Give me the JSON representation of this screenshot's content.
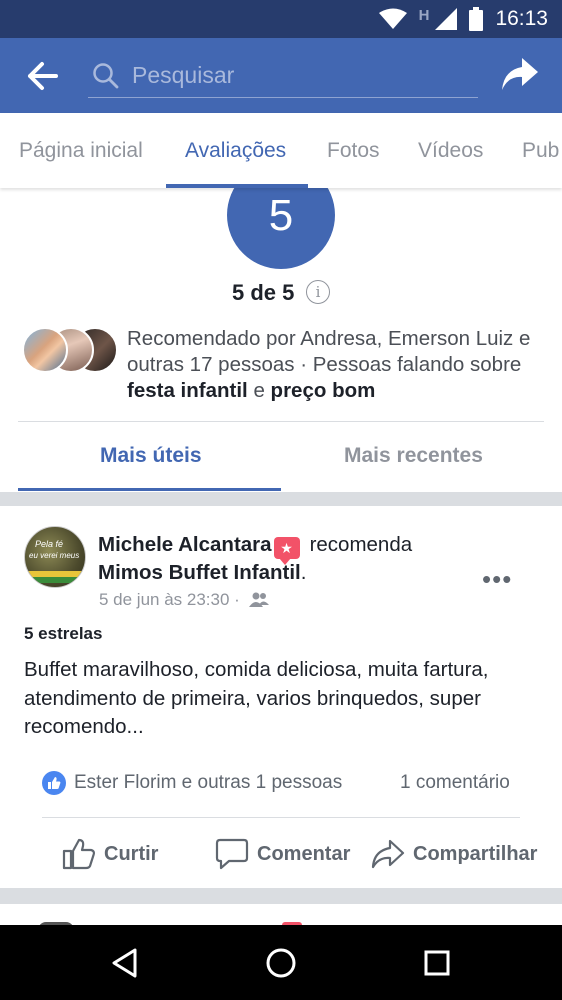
{
  "status_bar": {
    "time": "16:13",
    "network_letter": "H"
  },
  "app_bar": {
    "search_placeholder": "Pesquisar"
  },
  "tabs": [
    {
      "label": "Página inicial"
    },
    {
      "label": "Avaliações"
    },
    {
      "label": "Fotos"
    },
    {
      "label": "Vídeos"
    },
    {
      "label": "Pub"
    }
  ],
  "rating": {
    "value": "5",
    "summary": "5 de 5",
    "info_icon": "i",
    "recommend_prefix": "Recomendado por Andresa, Emerson Luiz e outras 17 pessoas · Pessoas falando sobre ",
    "topic1": "festa infantil",
    "conjunction": " e ",
    "topic2": "preço bom"
  },
  "sort_tabs": {
    "active": "Mais úteis",
    "inactive": "Mais recentes"
  },
  "post": {
    "avatar_text1": "Pela fé",
    "avatar_text2": "eu verei meus",
    "author": "Michele Alcantara",
    "badge_icon": "star-badge-icon",
    "verb": "recomenda",
    "page": "Mimos Buffet Infantil",
    "period": ".",
    "date": "5 de jun às 23:30 ·",
    "more": "•••",
    "stars": "5 estrelas",
    "body": "Buffet maravilhoso, comida deliciosa, muita fartura, atendimento de primeira, varios brinquedos, super recomendo...",
    "reactions": "Ester Florim e outras 1 pessoas",
    "comments": "1 comentário",
    "actions": {
      "like": "Curtir",
      "comment": "Comentar",
      "share": "Compartilhar"
    }
  },
  "colors": {
    "status_bar": "#273c6d",
    "brand": "#4267b2",
    "badge": "#f25268",
    "like": "#4a86f0",
    "muted_text": "#90949c",
    "separator": "#dadde1"
  }
}
